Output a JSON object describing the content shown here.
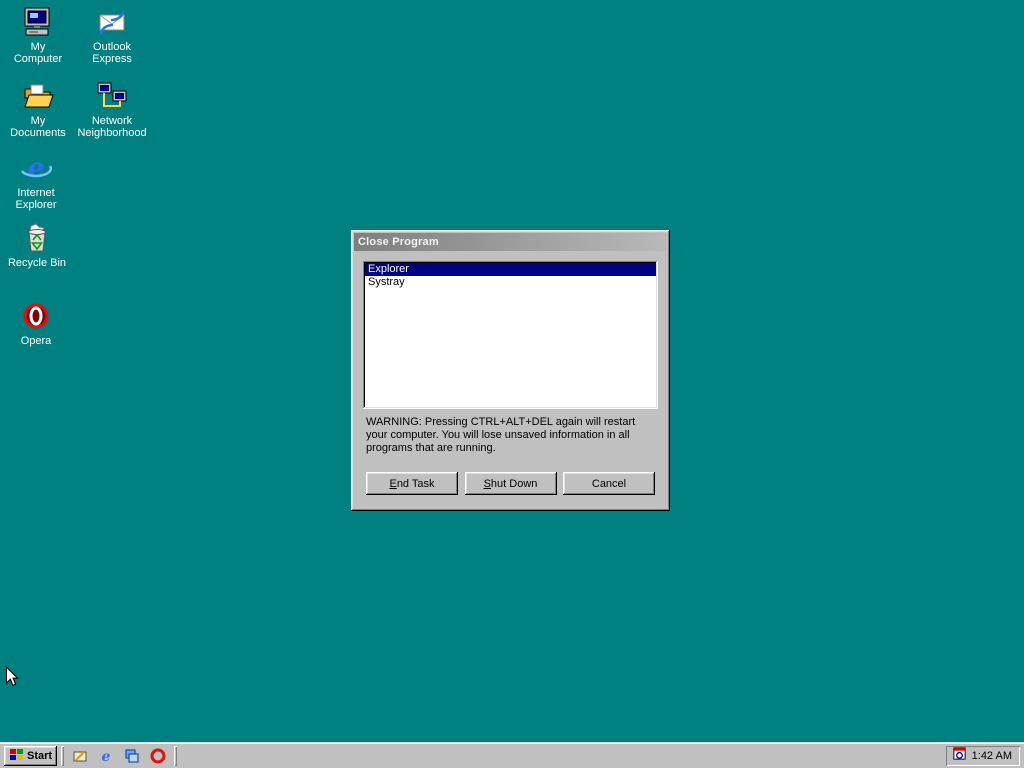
{
  "colors": {
    "desktop_background": "#008080",
    "selection": "#000080",
    "window_face": "#c0c0c0",
    "inactive_titlebar_start": "#7f7f7f",
    "inactive_titlebar_end": "#b9b9b9"
  },
  "desktop": {
    "icons": [
      {
        "label": "My Computer",
        "icon": "my-computer-icon"
      },
      {
        "label": "Outlook Express",
        "icon": "outlook-express-icon"
      },
      {
        "label": "My Documents",
        "icon": "my-documents-icon"
      },
      {
        "label": "Network Neighborhood",
        "icon": "network-neighborhood-icon"
      },
      {
        "label": "Internet Explorer",
        "icon": "internet-explorer-icon"
      },
      {
        "label": "Recycle Bin",
        "icon": "recycle-bin-icon"
      },
      {
        "label": "Opera",
        "icon": "opera-icon"
      }
    ]
  },
  "dialog": {
    "title": "Close Program",
    "tasks": [
      {
        "name": "Explorer",
        "selected": true
      },
      {
        "name": "Systray",
        "selected": false
      }
    ],
    "warning": "WARNING: Pressing CTRL+ALT+DEL again will restart your computer. You will lose unsaved information in all programs that are running.",
    "buttons": [
      {
        "label": "End Task",
        "hotkey": "E"
      },
      {
        "label": "Shut Down",
        "hotkey": "S"
      },
      {
        "label": "Cancel",
        "hotkey": ""
      }
    ]
  },
  "taskbar": {
    "start_label": "Start",
    "quick_launch": [
      {
        "icon": "show-desktop-icon"
      },
      {
        "icon": "internet-explorer-icon"
      },
      {
        "icon": "channels-icon"
      },
      {
        "icon": "opera-icon"
      }
    ],
    "clock": "1:42 AM"
  }
}
